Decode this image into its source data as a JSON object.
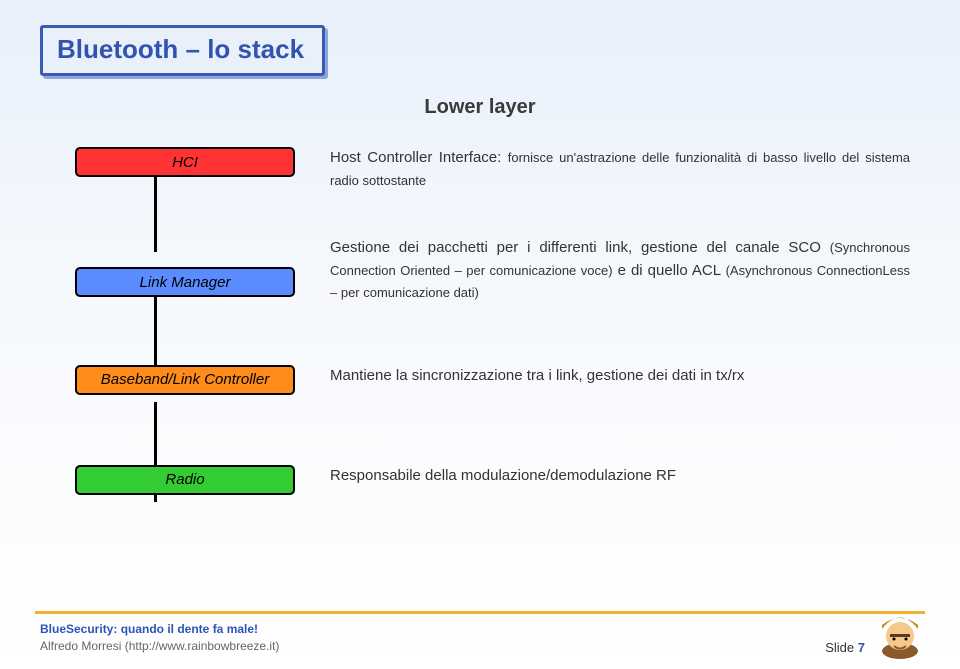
{
  "title": "Bluetooth – lo stack",
  "subtitle": "Lower layer",
  "layers": [
    {
      "name": "HCI",
      "desc_html": "Host Controller Interface: <small>fornisce un'astrazione delle funzionalità di basso livello del sistema radio sottostante</small>"
    },
    {
      "name": "Link Manager",
      "desc_html": "Gestione dei pacchetti per i differenti link, gestione del canale SCO <small>(Synchronous Connection Oriented – per comunicazione voce)</small> e di quello ACL <small>(Asynchronous ConnectionLess – per comunicazione dati)</small>"
    },
    {
      "name": "Baseband/Link Controller",
      "desc_html": "Mantiene la sincronizzazione tra i link, gestione dei dati in tx/rx"
    },
    {
      "name": "Radio",
      "desc_html": "Responsabile della modulazione/demodulazione  RF"
    }
  ],
  "footer": {
    "line1": "BlueSecurity: quando il dente fa male!",
    "line2": "Alfredo Morresi (http://www.rainbowbreeze.it)",
    "slide_label": "Slide ",
    "slide_number": "7"
  }
}
